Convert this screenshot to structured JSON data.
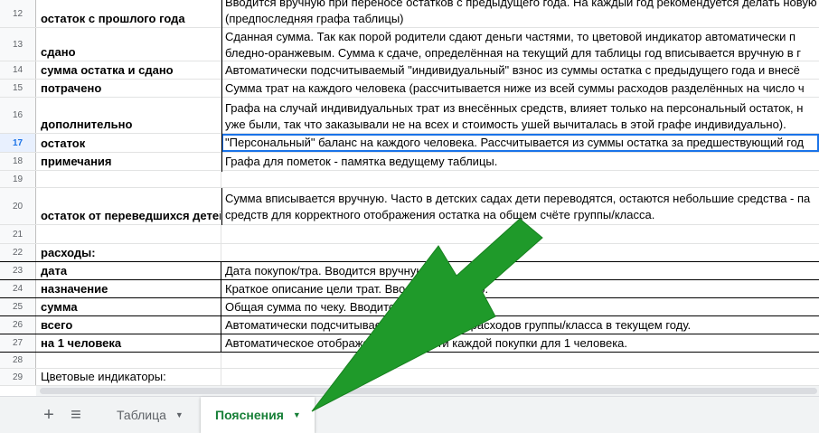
{
  "rows": [
    {
      "num": "12",
      "a": "остаток с прошлого года",
      "b1": "Вводится вручную при переносе остатков с предыдущего года. На каждый год рекомендуется делать новую",
      "b2": "(предпоследняя графа таблицы)"
    },
    {
      "num": "13",
      "a": "сдано",
      "b1": "Сданная сумма. Так как порой родители сдают деньги частями, то цветовой индикатор автоматически п",
      "b2": "бледно-оранжевым. Сумма к сдаче, определённая на текущий для таблицы год вписывается вручную в г"
    },
    {
      "num": "14",
      "a": "сумма остатка и сдано",
      "b1": "Автоматически подсчитываемый \"индивидуальный\" взнос из суммы остатка с предыдущего года и внесё"
    },
    {
      "num": "15",
      "a": "потрачено",
      "b1": "Сумма трат на каждого человека (рассчитывается ниже из всей суммы расходов разделённых на число ч"
    },
    {
      "num": "16",
      "a": "дополнительно",
      "b1": "Графа на случай индивидуальных трат из внесённых средств, влияет только на персональный остаток, н",
      "b2": " уже были, так что заказывали не на всех и стоимость ушей вычиталась в этой графе индивидуально)."
    },
    {
      "num": "17",
      "a": "остаток",
      "b1": "\"Персональный\" баланс на каждого человека. Рассчитывается из суммы остатка за предшествующий год"
    },
    {
      "num": "18",
      "a": "примечания",
      "b1": "Графа для пометок  - памятка ведущему таблицы."
    },
    {
      "num": "19",
      "a": "",
      "b1": ""
    },
    {
      "num": "20",
      "a": "остаток от переведшихся детей",
      "b1": "Сумма вписывается вручную. Часто в детских садах дети переводятся, остаются небольшие средства - па",
      "b2": "средств для корректного отображения остатка на общем счёте группы/класса."
    },
    {
      "num": "21",
      "a": "",
      "b1": ""
    },
    {
      "num": "22",
      "a": "расходы:",
      "b1": ""
    },
    {
      "num": "23",
      "a": "дата",
      "b1": "Дата покупок/тра. Вводится вручную."
    },
    {
      "num": "24",
      "a": "назначение",
      "b1": "Краткое описание цели трат. Вводится вручную."
    },
    {
      "num": "25",
      "a": "сумма",
      "b1": "Общая сумма по чеку. Вводится вручную."
    },
    {
      "num": "26",
      "a": "всего",
      "b1": "Автоматически подсчитываемая сумма всех расходов группы/класса в текущем году."
    },
    {
      "num": "27",
      "a": "на 1 человека",
      "b1": "Автоматическое отображение стоимости каждой покупки для 1 человека."
    },
    {
      "num": "28",
      "a": "",
      "b1": ""
    },
    {
      "num": "29",
      "a": "Цветовые индикаторы:",
      "b1": ""
    }
  ],
  "tabs": {
    "add_icon": "+",
    "list_icon": "≡",
    "sheet1": "Таблица",
    "sheet2": "Пояснения",
    "caret": "▼"
  },
  "colors": {
    "accent": "#188038",
    "selection": "#1a73e8",
    "arrow": "#1f9a2a"
  }
}
